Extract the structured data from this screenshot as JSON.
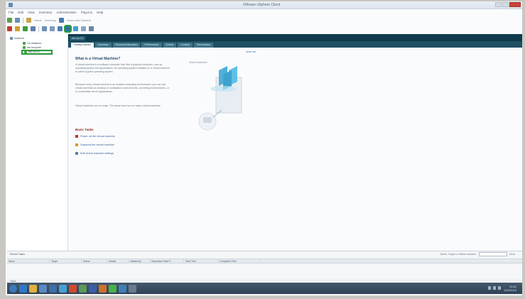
{
  "window": {
    "title": "VMware vSphere Client"
  },
  "menubar": [
    "File",
    "Edit",
    "View",
    "Inventory",
    "Administration",
    "Plug-ins",
    "Help"
  ],
  "toolbar1": {
    "nav_left": "Home",
    "nav_mid": "Inventory",
    "nav_right": "Hosts and Clusters"
  },
  "tree": {
    "root": "localhost",
    "items": [
      "vm-datastore",
      "win-template",
      "win-vm-01"
    ]
  },
  "tabs": {
    "header": "win-vm-01",
    "sub": [
      "Getting Started",
      "Summary",
      "Resource Allocation",
      "Performance",
      "Events",
      "Console",
      "Permissions"
    ]
  },
  "getting_started": {
    "close_link": "close tab",
    "title": "What is a Virtual Machine?",
    "paragraphs": [
      "A virtual machine is a software computer that, like a physical computer, runs an operating system and applications. An operating system installed on a virtual machine is called a guest operating system.",
      "Because every virtual machine is an isolated computing environment, you can use virtual machines as desktop or workstation environments, as testing environments, or to consolidate server applications.",
      "Virtual machines run on hosts. The same host can run many virtual machines."
    ],
    "diagram_label": "Virtual Machines",
    "tasks_title": "Basic Tasks",
    "tasks": [
      "Power on the virtual machine",
      "Suspend the virtual machine",
      "Edit virtual machine settings"
    ]
  },
  "recent_tasks": {
    "title": "Recent Tasks",
    "search_label": "Name, Target or Status contains:",
    "clear": "Clear",
    "columns": [
      "Name",
      "Target",
      "Status",
      "Details",
      "Initiated by",
      "Requested Start Ti",
      "Start Time",
      "Completed Time"
    ]
  },
  "statusbar": {
    "left": "Tasks"
  },
  "taskbar": {
    "time": "10:41",
    "date": "12/2/2013"
  },
  "colors": {
    "tab_dark": "#0f3a4c",
    "highlight_green": "#2a9a3a",
    "close_red": "#c9433a",
    "link_blue": "#3a62a0"
  }
}
